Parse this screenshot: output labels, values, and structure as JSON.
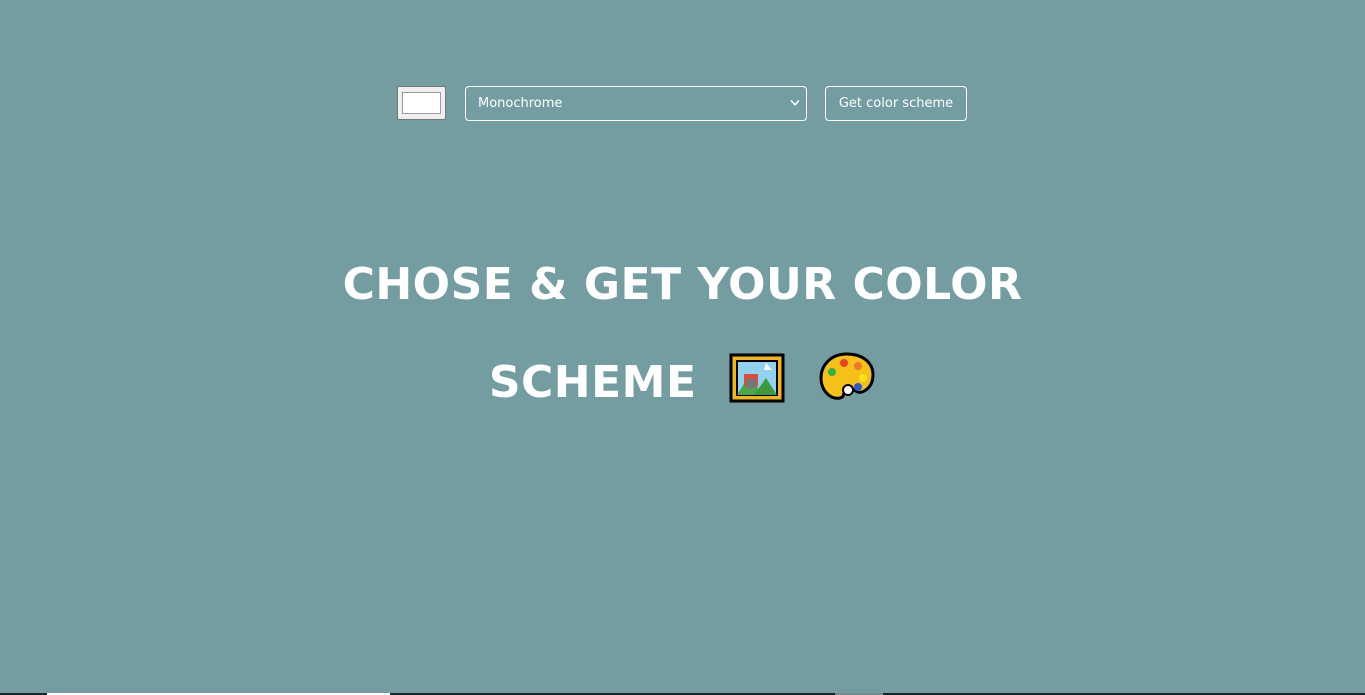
{
  "page": {
    "background_color": "#749da1"
  },
  "controls": {
    "color_input_value": "#ffffff",
    "mode_select": {
      "selected": "Monochrome"
    },
    "submit_label": "Get color scheme"
  },
  "headline": {
    "line1": "CHOSE & GET YOUR COLOR",
    "line2": "SCHEME",
    "icons": [
      "framed-picture-icon",
      "artist-palette-icon"
    ]
  }
}
